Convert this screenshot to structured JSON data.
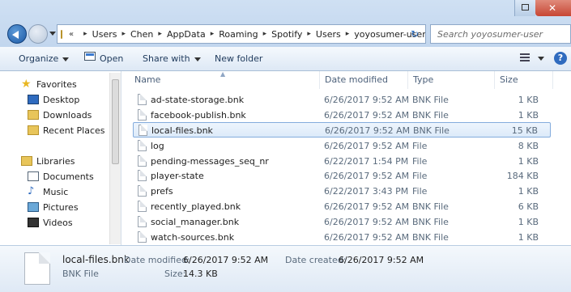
{
  "address": {
    "overflow": "«",
    "crumbs": [
      "Users",
      "Chen",
      "AppData",
      "Roaming",
      "Spotify",
      "Users",
      "yoyosumer-user"
    ]
  },
  "search": {
    "placeholder": "Search yoyosumer-user"
  },
  "toolbar": {
    "organize": "Organize",
    "open": "Open",
    "share_with": "Share with",
    "new_folder": "New folder"
  },
  "nav": {
    "favorites": "Favorites",
    "desktop": "Desktop",
    "downloads": "Downloads",
    "recent": "Recent Places",
    "libraries": "Libraries",
    "documents": "Documents",
    "music": "Music",
    "pictures": "Pictures",
    "videos": "Videos"
  },
  "columns": {
    "name": "Name",
    "date": "Date modified",
    "type": "Type",
    "size": "Size"
  },
  "files": [
    {
      "name": "ad-state-storage.bnk",
      "date": "6/26/2017 9:52 AM",
      "type": "BNK File",
      "size": "1 KB"
    },
    {
      "name": "facebook-publish.bnk",
      "date": "6/26/2017 9:52 AM",
      "type": "BNK File",
      "size": "1 KB"
    },
    {
      "name": "local-files.bnk",
      "date": "6/26/2017 9:52 AM",
      "type": "BNK File",
      "size": "15 KB",
      "selected": true
    },
    {
      "name": "log",
      "date": "6/26/2017 9:52 AM",
      "type": "File",
      "size": "8 KB"
    },
    {
      "name": "pending-messages_seq_nr",
      "date": "6/22/2017 1:54 PM",
      "type": "File",
      "size": "1 KB"
    },
    {
      "name": "player-state",
      "date": "6/26/2017 9:52 AM",
      "type": "File",
      "size": "184 KB"
    },
    {
      "name": "prefs",
      "date": "6/22/2017 3:43 PM",
      "type": "File",
      "size": "1 KB"
    },
    {
      "name": "recently_played.bnk",
      "date": "6/26/2017 9:52 AM",
      "type": "BNK File",
      "size": "6 KB"
    },
    {
      "name": "social_manager.bnk",
      "date": "6/26/2017 9:52 AM",
      "type": "BNK File",
      "size": "1 KB"
    },
    {
      "name": "watch-sources.bnk",
      "date": "6/26/2017 9:52 AM",
      "type": "BNK File",
      "size": "1 KB"
    }
  ],
  "details": {
    "name": "local-files.bnk",
    "type": "BNK File",
    "date_modified_label": "Date modified:",
    "date_modified": "6/26/2017 9:52 AM",
    "size_label": "Size:",
    "size": "14.3 KB",
    "date_created_label": "Date created:",
    "date_created": "6/26/2017 9:52 AM"
  }
}
